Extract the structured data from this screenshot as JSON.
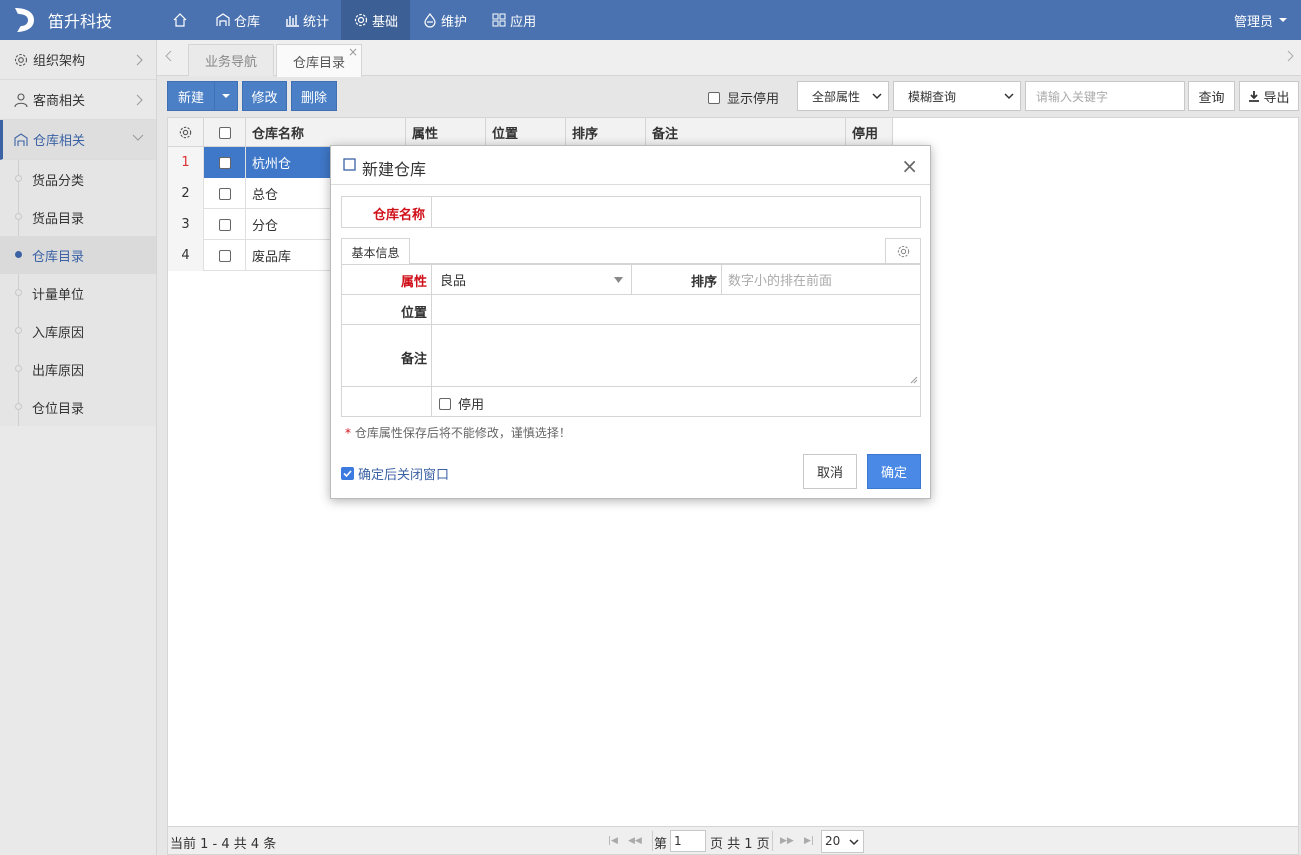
{
  "app": {
    "brand": "笛升科技",
    "user": "管理员"
  },
  "nav": [
    {
      "label": "",
      "icon": "home-icon"
    },
    {
      "label": "仓库",
      "icon": "warehouse-icon"
    },
    {
      "label": "统计",
      "icon": "bar-chart-icon"
    },
    {
      "label": "基础",
      "icon": "gear-icon"
    },
    {
      "label": "维护",
      "icon": "maintenance-icon"
    },
    {
      "label": "应用",
      "icon": "apps-icon"
    }
  ],
  "sidebar": {
    "groups": [
      {
        "label": "组织架构",
        "icon": "gear-icon"
      },
      {
        "label": "客商相关",
        "icon": "user-icon"
      },
      {
        "label": "仓库相关",
        "icon": "warehouse-icon"
      }
    ],
    "items": [
      "货品分类",
      "货品目录",
      "仓库目录",
      "计量单位",
      "入库原因",
      "出库原因",
      "仓位目录"
    ]
  },
  "tabs": [
    {
      "label": "业务导航"
    },
    {
      "label": "仓库目录",
      "close": "×"
    }
  ],
  "toolbar": {
    "new": "新建",
    "edit": "修改",
    "delete": "删除",
    "show_disabled": "显示停用",
    "attr_filter": "全部属性",
    "query_mode": "模糊查询",
    "search_placeholder": "请输入关键字",
    "query": "查询",
    "export": "导出"
  },
  "grid": {
    "columns": [
      "仓库名称",
      "属性",
      "位置",
      "排序",
      "备注",
      "停用"
    ],
    "rows": [
      {
        "num": "1",
        "name": "杭州仓"
      },
      {
        "num": "2",
        "name": "总仓"
      },
      {
        "num": "3",
        "name": "分仓"
      },
      {
        "num": "4",
        "name": "废品库"
      }
    ]
  },
  "pager": {
    "summary": "当前 1 - 4 共 4 条",
    "page_prefix": "第",
    "page": "1",
    "page_suffix": "页 共 1 页",
    "page_size": "20"
  },
  "modal": {
    "title": "新建仓库",
    "close": "×",
    "name_label": "仓库名称",
    "tab_basic": "基本信息",
    "attr_label": "属性",
    "attr_value": "良品",
    "sort_label": "排序",
    "sort_placeholder": "数字小的排在前面",
    "location_label": "位置",
    "remark_label": "备注",
    "disabled_label": "停用",
    "note_star": "*",
    "note": "仓库属性保存后将不能修改，谨慎选择！",
    "close_after": "确定后关闭窗口",
    "cancel": "取消",
    "ok": "确定"
  }
}
